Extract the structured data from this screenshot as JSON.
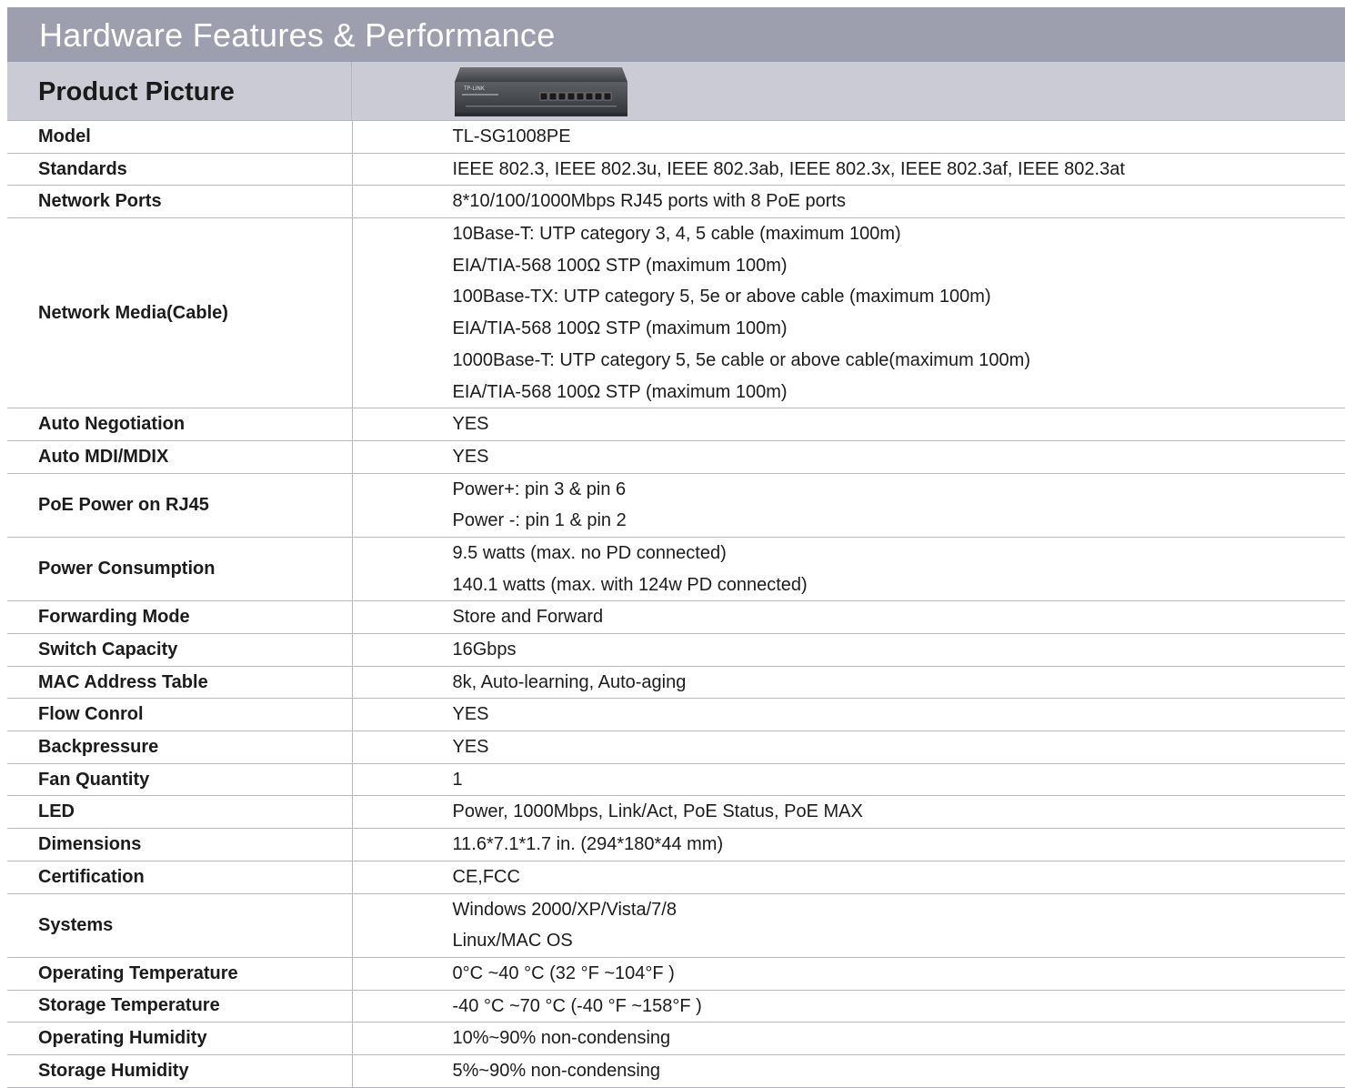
{
  "header": {
    "title": "Hardware Features & Performance"
  },
  "product_picture": {
    "label": "Product Picture",
    "device_brand": "TP-LINK",
    "device_ports": 8,
    "colors": {
      "body": "#3c3f44",
      "face": "#55585d",
      "port": "#1a1a1a"
    }
  },
  "specs": [
    {
      "label": "Model",
      "values": [
        "TL-SG1008PE"
      ]
    },
    {
      "label": "Standards",
      "values": [
        "IEEE 802.3, IEEE 802.3u, IEEE 802.3ab, IEEE 802.3x, IEEE 802.3af, IEEE 802.3at"
      ]
    },
    {
      "label": "Network Ports",
      "values": [
        "8*10/100/1000Mbps RJ45 ports with 8 PoE ports"
      ]
    },
    {
      "label": "Network Media(Cable)",
      "values": [
        "10Base-T: UTP category 3, 4, 5 cable (maximum 100m)",
        "EIA/TIA-568 100Ω STP (maximum 100m)",
        "100Base-TX: UTP category 5, 5e or above cable (maximum 100m)",
        "EIA/TIA-568 100Ω STP (maximum 100m)",
        "1000Base-T: UTP category 5, 5e cable or above cable(maximum 100m)",
        "EIA/TIA-568 100Ω STP (maximum 100m)"
      ]
    },
    {
      "label": "Auto Negotiation",
      "values": [
        "YES"
      ]
    },
    {
      "label": "Auto MDI/MDIX",
      "values": [
        "YES"
      ]
    },
    {
      "label": "PoE Power on RJ45",
      "values": [
        "Power+: pin 3 & pin 6",
        "Power -: pin 1 & pin 2"
      ]
    },
    {
      "label": "Power Consumption",
      "values": [
        "9.5 watts (max. no PD connected)",
        "140.1 watts (max. with 124w PD connected)"
      ]
    },
    {
      "label": "Forwarding Mode",
      "values": [
        "Store and Forward"
      ]
    },
    {
      "label": "Switch Capacity",
      "values": [
        "16Gbps"
      ]
    },
    {
      "label": "MAC Address Table",
      "values": [
        "8k, Auto-learning, Auto-aging"
      ]
    },
    {
      "label": "Flow Conrol",
      "values": [
        "YES"
      ]
    },
    {
      "label": "Backpressure",
      "values": [
        "YES"
      ]
    },
    {
      "label": "Fan Quantity",
      "values": [
        "1"
      ]
    },
    {
      "label": "LED",
      "values": [
        "Power, 1000Mbps, Link/Act, PoE Status, PoE MAX"
      ]
    },
    {
      "label": "Dimensions",
      "values": [
        "11.6*7.1*1.7 in. (294*180*44 mm)"
      ]
    },
    {
      "label": "Certification",
      "values": [
        "CE,FCC"
      ]
    },
    {
      "label": "Systems",
      "values": [
        "Windows 2000/XP/Vista/7/8",
        "Linux/MAC OS"
      ]
    },
    {
      "label": "Operating Temperature",
      "values": [
        "0°C ~40 °C (32 °F ~104°F )"
      ]
    },
    {
      "label": "Storage Temperature",
      "values": [
        "-40 °C ~70 °C (-40 °F ~158°F )"
      ]
    },
    {
      "label": "Operating Humidity",
      "values": [
        "10%~90% non-condensing"
      ]
    },
    {
      "label": "Storage Humidity",
      "values": [
        "5%~90% non-condensing"
      ]
    }
  ]
}
